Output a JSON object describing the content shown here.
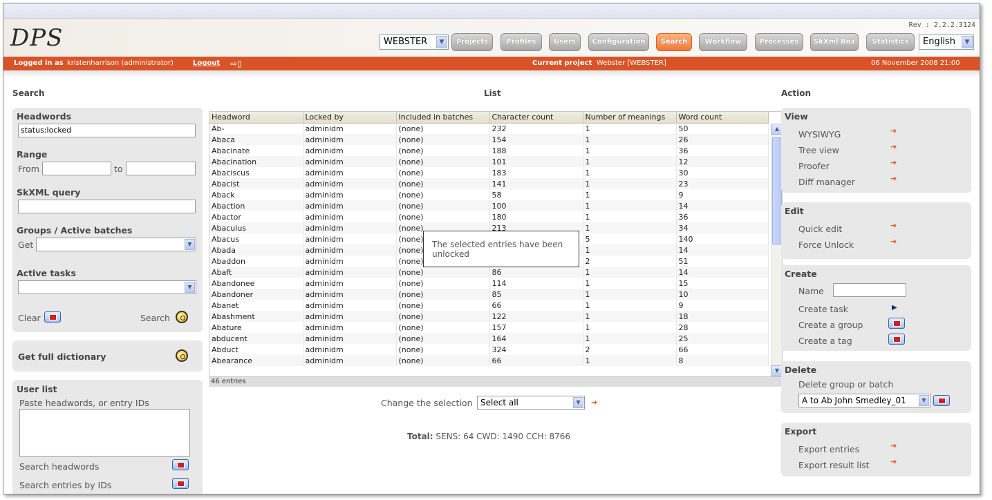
{
  "header": {
    "logo": "DPS",
    "rev": "Rev : 2.2.2.3124",
    "project_select": "WEBSTER",
    "nav": [
      "Projects",
      "Profiles",
      "Users",
      "Configuration",
      "Search",
      "Workflow",
      "Processes",
      "SkXml Box",
      "Statistics"
    ],
    "active_nav": "Search",
    "language": "English"
  },
  "statusbar": {
    "logged_in_label": "Logged in as",
    "user": "kristenharrison (administrator)",
    "logout": "Logout",
    "current_project_label": "Current project",
    "current_project": "Webster [WEBSTER]",
    "datetime": "06 November 2008 21:00"
  },
  "search": {
    "heading": "Search",
    "headwords_label": "Headwords",
    "headwords_value": "status:locked",
    "range_label": "Range",
    "from_label": "From",
    "to_label": "to",
    "skxml_label": "SkXML query",
    "groups_label": "Groups / Active batches",
    "get_label": "Get",
    "tasks_label": "Active tasks",
    "clear_label": "Clear",
    "search_label": "Search",
    "full_dict_label": "Get full dictionary",
    "userlist_label": "User list",
    "userlist_hint": "Paste headwords, or entry IDs",
    "search_headwords": "Search headwords",
    "search_ids": "Search entries by IDs"
  },
  "list": {
    "heading": "List",
    "columns": [
      "Headword",
      "Locked by",
      "Included in batches",
      "Character count",
      "Number of meanings",
      "Word count"
    ],
    "rows": [
      [
        "Ab-",
        "adminidm",
        "(none)",
        "232",
        "1",
        "50"
      ],
      [
        "Abaca",
        "adminidm",
        "(none)",
        "154",
        "1",
        "26"
      ],
      [
        "Abacinate",
        "adminidm",
        "(none)",
        "188",
        "1",
        "36"
      ],
      [
        "Abacination",
        "adminidm",
        "(none)",
        "101",
        "1",
        "12"
      ],
      [
        "Abaciscus",
        "adminidm",
        "(none)",
        "183",
        "1",
        "30"
      ],
      [
        "Abacist",
        "adminidm",
        "(none)",
        "141",
        "1",
        "23"
      ],
      [
        "Aback",
        "adminidm",
        "(none)",
        "58",
        "1",
        "9"
      ],
      [
        "Abaction",
        "adminidm",
        "(none)",
        "100",
        "1",
        "14"
      ],
      [
        "Abactor",
        "adminidm",
        "(none)",
        "180",
        "1",
        "36"
      ],
      [
        "Abaculus",
        "adminidm",
        "(none)",
        "213",
        "1",
        "34"
      ],
      [
        "Abacus",
        "adminidm",
        "(none)",
        "",
        "5",
        "140"
      ],
      [
        "Abada",
        "adminidm",
        "(none)",
        "",
        "1",
        "14"
      ],
      [
        "Abaddon",
        "adminidm",
        "(none)",
        "",
        "2",
        "51"
      ],
      [
        "Abaft",
        "adminidm",
        "(none)",
        "86",
        "1",
        "14"
      ],
      [
        "Abandonee",
        "adminidm",
        "(none)",
        "114",
        "1",
        "15"
      ],
      [
        "Abandoner",
        "adminidm",
        "(none)",
        "85",
        "1",
        "10"
      ],
      [
        "Abanet",
        "adminidm",
        "(none)",
        "66",
        "1",
        "9"
      ],
      [
        "Abashment",
        "adminidm",
        "(none)",
        "122",
        "1",
        "18"
      ],
      [
        "Abature",
        "adminidm",
        "(none)",
        "157",
        "1",
        "28"
      ],
      [
        "abducent",
        "adminidm",
        "(none)",
        "164",
        "1",
        "25"
      ],
      [
        "Abduct",
        "adminidm",
        "(none)",
        "324",
        "2",
        "66"
      ],
      [
        "Abearance",
        "adminidm",
        "(none)",
        "66",
        "1",
        "8"
      ]
    ],
    "entries_count": "46 entries",
    "toast": "The selected entries have been unlocked",
    "change_selection_label": "Change the selection",
    "change_selection_value": "Select all",
    "total_label": "Total:",
    "total_value": "SENS: 64 CWD: 1490 CCH: 8766"
  },
  "action": {
    "heading": "Action",
    "view_title": "View",
    "view_items": [
      "WYSIWYG",
      "Tree view",
      "Proofer",
      "Diff manager"
    ],
    "edit_title": "Edit",
    "edit_items": [
      "Quick edit",
      "Force Unlock"
    ],
    "create_title": "Create",
    "name_label": "Name",
    "create_task": "Create task",
    "create_group": "Create a group",
    "create_tag": "Create a tag",
    "delete_title": "Delete",
    "delete_label": "Delete group or batch",
    "delete_value": "A to Ab John Smedley_01",
    "export_title": "Export",
    "export_items": [
      "Export entries",
      "Export result list"
    ]
  }
}
